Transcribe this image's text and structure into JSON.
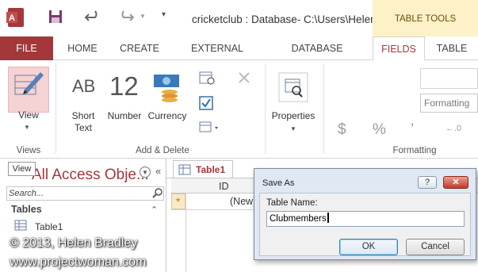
{
  "window": {
    "title": "cricketclub : Database- C:\\Users\\Helen..."
  },
  "contextual": {
    "label": "TABLE TOOLS"
  },
  "tabs": [
    "FILE",
    "HOME",
    "CREATE",
    "EXTERNAL DATA",
    "DATABASE TOOLS",
    "FIELDS",
    "TABLE"
  ],
  "ribbon": {
    "view_label": "View",
    "views_group": "Views",
    "add_delete_group": "Add & Delete",
    "formatting_group": "Formatting",
    "short_text_line1": "Short",
    "short_text_line2": "Text",
    "number_icon": "12",
    "number_label": "Number",
    "currency_label": "Currency",
    "properties_label": "Properties",
    "formatting_box": "Formatting",
    "ab_icon": "AB",
    "fmt_dollar": "$",
    "fmt_percent": "%",
    "fmt_comma": "’",
    "fmt_decimal": "←.0"
  },
  "tooltip": "View",
  "nav": {
    "title": "All Access Obje...",
    "search_placeholder": "Search...",
    "section": "Tables",
    "items": [
      "Table1"
    ]
  },
  "document": {
    "tab_label": "Table1",
    "column_header": "ID",
    "new_row_marker": "*",
    "new_row_value": "(New)"
  },
  "dialog": {
    "title": "Save As",
    "field_label": "Table Name:",
    "field_value": "Clubmembers",
    "ok": "OK",
    "cancel": "Cancel",
    "help": "?",
    "close": "✕"
  },
  "watermark": {
    "line1": "© 2013, Helen Bradley",
    "line2": "www.projectwoman.com"
  },
  "colors": {
    "accent": "#a4373a",
    "context_tab": "#fdf1c7"
  }
}
